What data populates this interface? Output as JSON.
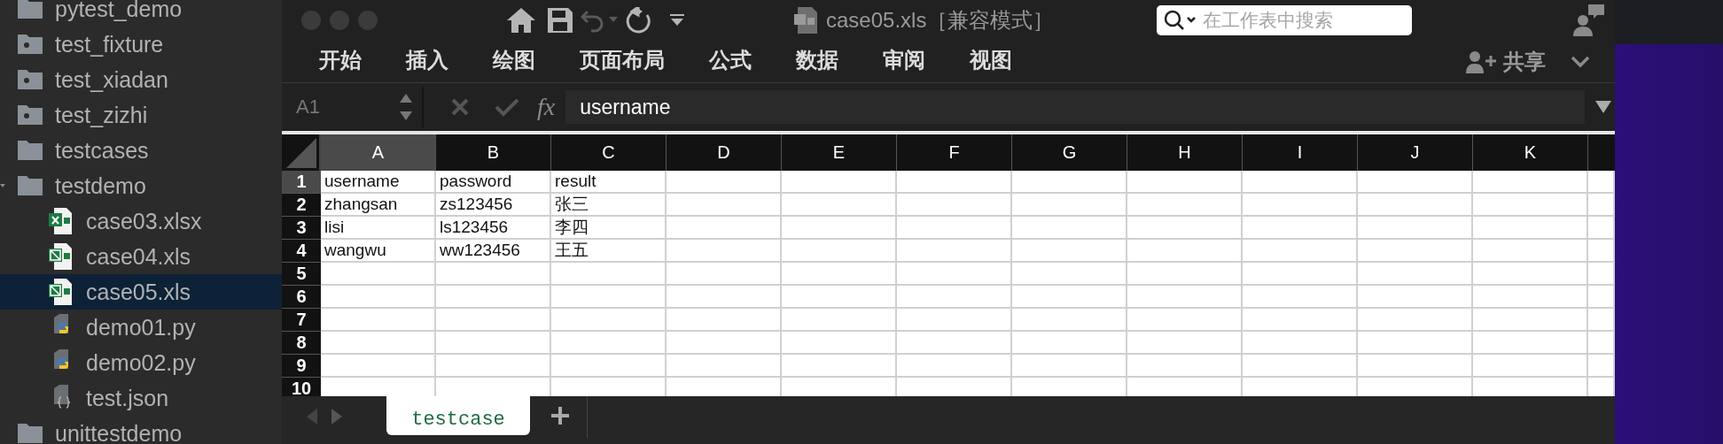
{
  "sidebar": {
    "items": [
      {
        "label": "pytest_demo",
        "kind": "folder",
        "selected": false
      },
      {
        "label": "test_fixture",
        "kind": "package",
        "selected": false
      },
      {
        "label": "test_xiadan",
        "kind": "package",
        "selected": false
      },
      {
        "label": "test_zizhi",
        "kind": "package",
        "selected": false
      },
      {
        "label": "testcases",
        "kind": "folder",
        "selected": false
      },
      {
        "label": "testdemo",
        "kind": "folder",
        "selected": false,
        "expanded": true,
        "children": [
          {
            "label": "case03.xlsx",
            "kind": "xlsx",
            "selected": false
          },
          {
            "label": "case04.xls",
            "kind": "xls",
            "selected": false
          },
          {
            "label": "case05.xls",
            "kind": "xls",
            "selected": true
          },
          {
            "label": "demo01.py",
            "kind": "python",
            "selected": false
          },
          {
            "label": "demo02.py",
            "kind": "python",
            "selected": false
          },
          {
            "label": "test.json",
            "kind": "json",
            "selected": false
          }
        ]
      },
      {
        "label": "unittestdemo",
        "kind": "folder",
        "selected": false
      }
    ]
  },
  "window": {
    "title": "case05.xls［兼容模式］",
    "search": {
      "placeholder": "在工作表中搜索"
    }
  },
  "ribbon": {
    "tabs": [
      {
        "label": "开始",
        "selected": false
      },
      {
        "label": "插入",
        "selected": false
      },
      {
        "label": "绘图",
        "selected": false
      },
      {
        "label": "页面布局",
        "selected": false
      },
      {
        "label": "公式",
        "selected": false
      },
      {
        "label": "数据",
        "selected": false
      },
      {
        "label": "审阅",
        "selected": false
      },
      {
        "label": "视图",
        "selected": false
      }
    ],
    "share": "共享"
  },
  "formula_bar": {
    "name_box": "A1",
    "fx": "fx",
    "value": "username"
  },
  "sheet": {
    "columns": [
      {
        "label": "A",
        "selected": true
      },
      {
        "label": "B",
        "selected": false
      },
      {
        "label": "C",
        "selected": false
      },
      {
        "label": "D",
        "selected": false
      },
      {
        "label": "E",
        "selected": false
      },
      {
        "label": "F",
        "selected": false
      },
      {
        "label": "G",
        "selected": false
      },
      {
        "label": "H",
        "selected": false
      },
      {
        "label": "I",
        "selected": false
      },
      {
        "label": "J",
        "selected": false
      },
      {
        "label": "K",
        "selected": false
      }
    ],
    "rows": [
      {
        "number": "1",
        "selected": true,
        "cells": [
          "username",
          "password",
          "result"
        ]
      },
      {
        "number": "2",
        "selected": false,
        "cells": [
          "zhangsan",
          "zs123456",
          "张三"
        ]
      },
      {
        "number": "3",
        "selected": false,
        "cells": [
          "lisi",
          "ls123456",
          "李四"
        ]
      },
      {
        "number": "4",
        "selected": false,
        "cells": [
          "wangwu",
          "ww123456",
          "王五"
        ]
      },
      {
        "number": "5",
        "selected": false
      },
      {
        "number": "6",
        "selected": false
      },
      {
        "number": "7",
        "selected": false
      },
      {
        "number": "8",
        "selected": false
      },
      {
        "number": "9",
        "selected": false
      },
      {
        "number": "10",
        "selected": false
      }
    ]
  },
  "sheet_tabs": [
    {
      "label": "testcase",
      "selected": true
    }
  ]
}
